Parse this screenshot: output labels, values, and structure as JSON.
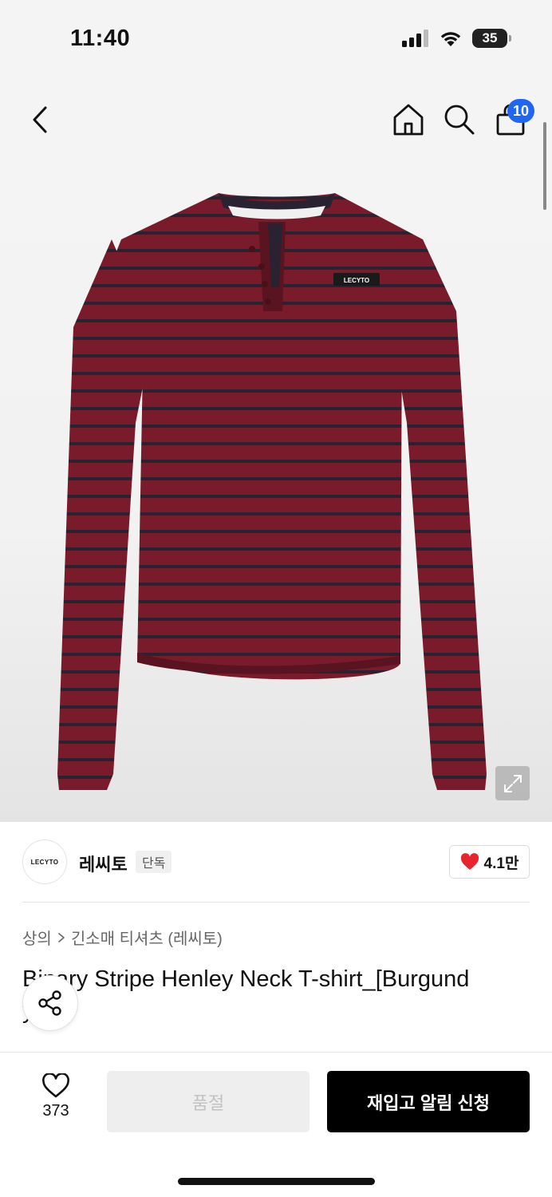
{
  "status_bar": {
    "time": "11:40",
    "battery": "35",
    "icons": [
      "cellular-signal-icon",
      "wifi-icon",
      "battery-icon"
    ]
  },
  "nav": {
    "icons": [
      "back-arrow-icon",
      "home-icon",
      "search-icon",
      "shopping-bag-icon"
    ],
    "cart_count": "10"
  },
  "product_image": {
    "logo_text": "LECYTO",
    "colors": {
      "shirt": "#7a1b2c",
      "stripe": "#2a2230"
    },
    "expand_icon": "expand-icon"
  },
  "brand": {
    "logo_text": "LECYTO",
    "name": "레씨토",
    "tag": "단독",
    "likes": "4.1만",
    "heart_color": "#e8242e"
  },
  "breadcrumb": {
    "items": [
      "상의",
      "긴소매 티셔츠 (레씨토)"
    ]
  },
  "product": {
    "title_line1": "Binary Stripe Henley Neck T-shirt_[Burgund",
    "title_line2": "y]"
  },
  "bottom_bar": {
    "wish_count": "373",
    "soldout_label": "품절",
    "restock_label": "재입고 알림 신청"
  }
}
